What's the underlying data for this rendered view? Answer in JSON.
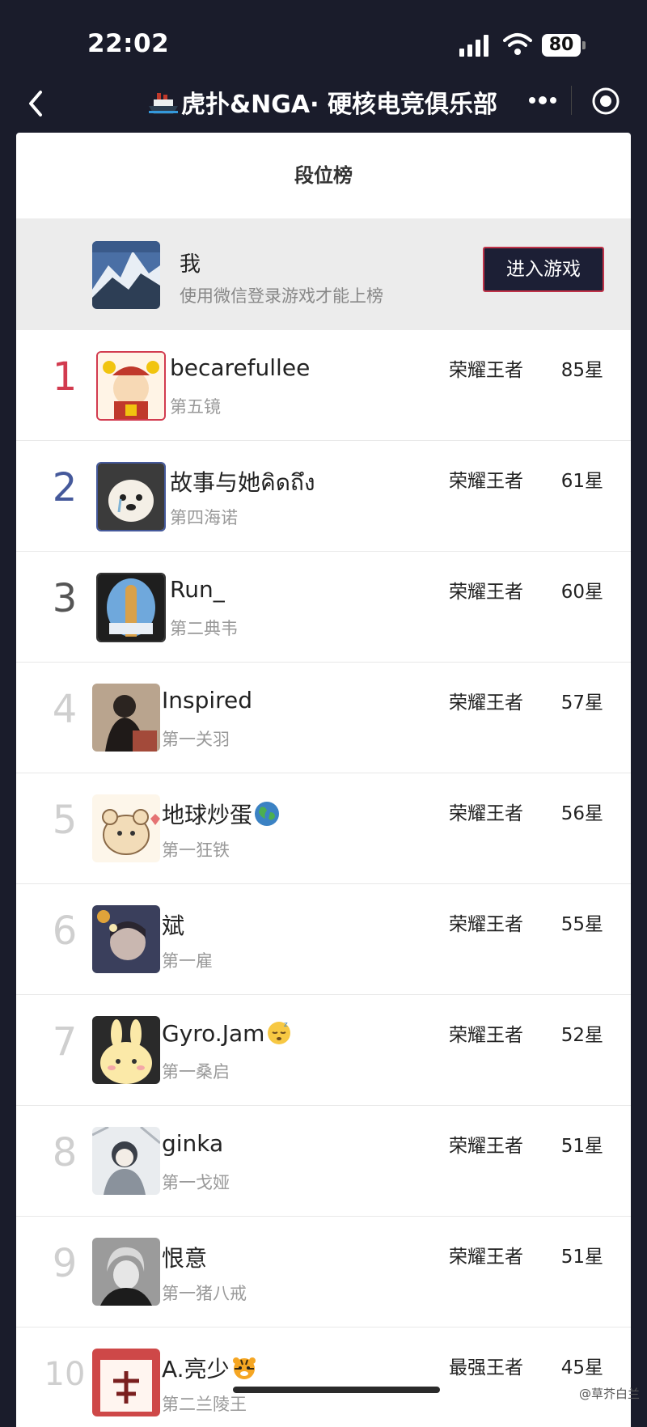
{
  "status": {
    "time": "22:02",
    "battery": "80"
  },
  "nav": {
    "title": "虎扑&NGA· 硬核电竞俱乐部"
  },
  "panel": {
    "title": "段位榜"
  },
  "me": {
    "name": "我",
    "hint": "使用微信登录游戏才能上榜",
    "button": "进入游戏"
  },
  "rows": [
    {
      "rank": "1",
      "name": "becarefullee",
      "sub": "第五镜",
      "tier": "荣耀王者",
      "stars": "85星"
    },
    {
      "rank": "2",
      "name": "故事与她คิดถึง",
      "sub": "第四海诺",
      "tier": "荣耀王者",
      "stars": "61星"
    },
    {
      "rank": "3",
      "name": "Run_",
      "sub": "第二典韦",
      "tier": "荣耀王者",
      "stars": "60星"
    },
    {
      "rank": "4",
      "name": "Inspired",
      "sub": "第一关羽",
      "tier": "荣耀王者",
      "stars": "57星"
    },
    {
      "rank": "5",
      "name": "地球炒蛋",
      "sub": "第一狂铁",
      "tier": "荣耀王者",
      "stars": "56星"
    },
    {
      "rank": "6",
      "name": "斌",
      "sub": "第一雇",
      "tier": "荣耀王者",
      "stars": "55星"
    },
    {
      "rank": "7",
      "name": "Gyro.Jam",
      "sub": "第一桑启",
      "tier": "荣耀王者",
      "stars": "52星"
    },
    {
      "rank": "8",
      "name": "ginka",
      "sub": "第一戈娅",
      "tier": "荣耀王者",
      "stars": "51星"
    },
    {
      "rank": "9",
      "name": "恨意",
      "sub": "第一猪八戒",
      "tier": "荣耀王者",
      "stars": "51星"
    },
    {
      "rank": "10",
      "name": "A.亮少",
      "sub": "第二兰陵王",
      "tier": "最强王者",
      "stars": "45星"
    }
  ],
  "watermark": "@草芥白兰",
  "colors": {
    "rank1": "#d23b4f",
    "rank2": "#45599b",
    "rank3": "#555555",
    "button_bg": "#1c1f35",
    "button_border": "#c03349"
  }
}
